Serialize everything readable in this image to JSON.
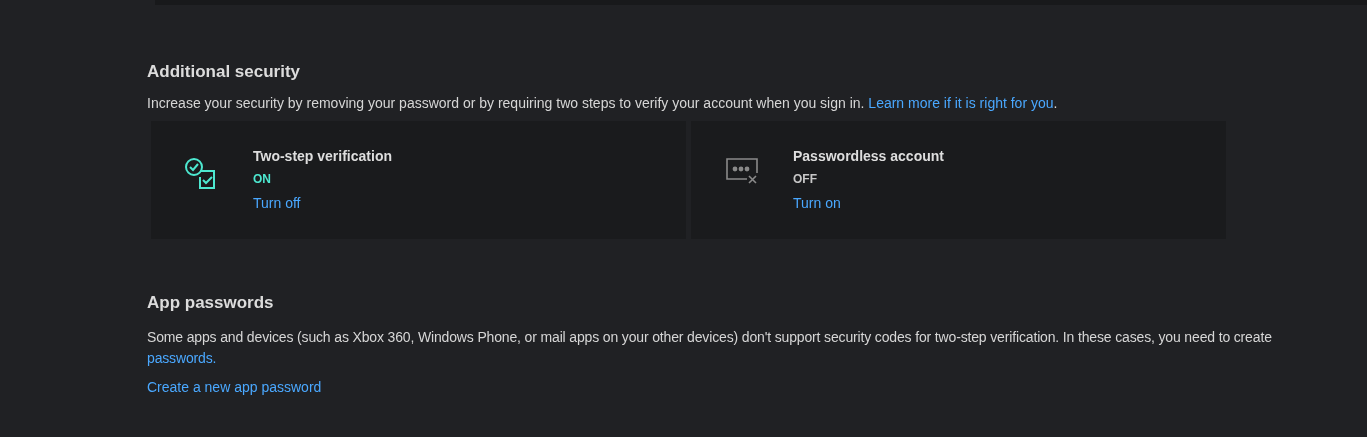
{
  "additional_security": {
    "heading": "Additional security",
    "description": "Increase your security by removing your password or by requiring two steps to verify your account when you sign in.",
    "description_link": "Learn more if it is right for you",
    "description_end": ".",
    "options": [
      {
        "kind": "two-step",
        "title": "Two-step verification",
        "on": true,
        "status": "ON",
        "action": "Turn off"
      },
      {
        "kind": "passwordless",
        "title": "Passwordless account",
        "on": false,
        "status": "OFF",
        "action": "Turn on"
      }
    ]
  },
  "app_passwords": {
    "heading": "App passwords",
    "description": "Some apps and devices (such as Xbox 360, Windows Phone, or mail apps on your other devices) don't support security codes for two-step verification. In these cases, you need to create",
    "description_link": "passwords.",
    "action": "Create a new app password"
  }
}
